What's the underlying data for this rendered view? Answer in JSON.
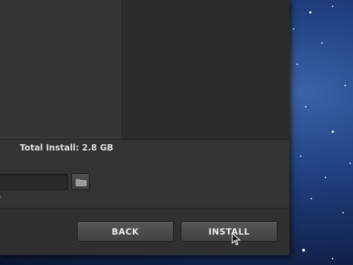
{
  "installer": {
    "total_install_label": "Total Install: 2.8 GB",
    "path_value": "",
    "path_note": ")"
  },
  "buttons": {
    "back_label": "BACK",
    "install_label": "INSTALL"
  },
  "icons": {
    "browse": "folder-icon",
    "pointer": "mouse-cursor-icon"
  },
  "colors": {
    "window_bg": "#333333",
    "button_bg": "#4a4a4a",
    "desktop_bg": "#1f3f7e"
  }
}
